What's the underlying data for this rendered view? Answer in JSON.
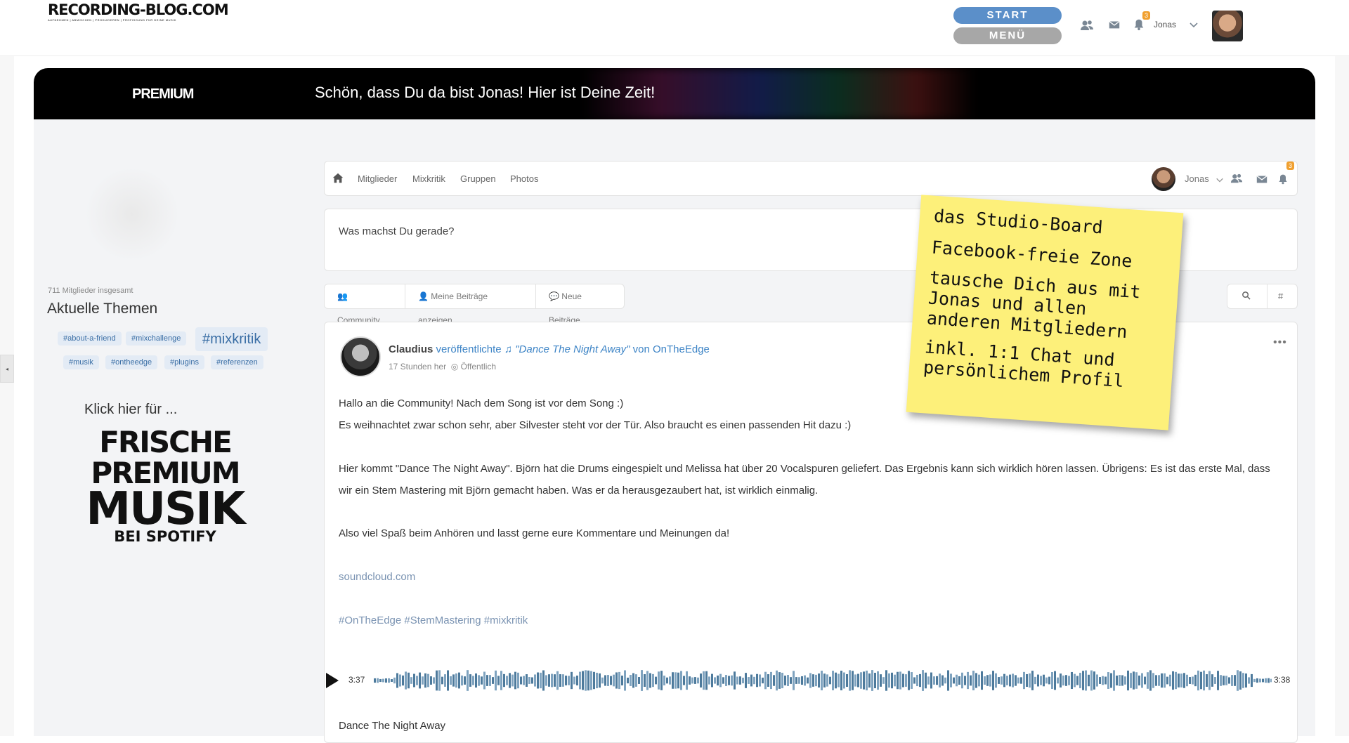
{
  "site": {
    "logo": "RECORDING-BLOG.COM",
    "tagline": "AUFNEHMEN | ABMISCHEN | PRODUZIEREN | PROFISOUND FÜR DEINE MUSIK"
  },
  "header": {
    "start_label": "START",
    "menu_label": "MENÜ",
    "notification_count": "3",
    "user_name": "Jonas"
  },
  "banner": {
    "premium_label": "PREMIUM",
    "welcome_text": "Schön, dass Du da bist Jonas! Hier ist Deine Zeit!"
  },
  "sidebar": {
    "members_count": "711 Mitglieder insgesamt",
    "topics_title": "Aktuelle Themen",
    "tags": [
      "#about-a-friend",
      "#mixchallenge",
      "#mixkritik",
      "#musik",
      "#ontheedge",
      "#plugins",
      "#referenzen"
    ],
    "promo_intro": "Klick hier für ...",
    "promo_lines": [
      "FRISCHE",
      "PREMIUM",
      "MUSIK",
      "BEI SPOTIFY"
    ]
  },
  "nav": {
    "links": [
      "Mitglieder",
      "Mixkritik",
      "Gruppen",
      "Photos"
    ],
    "user_name": "Jonas",
    "notification_count": "3"
  },
  "status": {
    "placeholder": "Was machst Du gerade?"
  },
  "filters": {
    "items": [
      "Community",
      "Meine Beiträge anzeigen",
      "Neue Beiträge"
    ],
    "search_symbol": "#"
  },
  "post": {
    "author": "Claudius",
    "verb": "veröffentlichte",
    "song": "\"Dance The Night Away\"",
    "by": "von",
    "artist": "OnTheEdge",
    "time": "17 Stunden her",
    "visibility": "Öffentlich",
    "paragraphs": [
      "Hallo an die Community! Nach dem Song ist vor dem Song :)",
      "Es weihnachtet zwar schon sehr, aber Silvester steht vor der Tür. Also braucht es einen passenden Hit dazu :)",
      "Hier kommt \"Dance The Night Away\". Björn hat die Drums eingespielt und Melissa hat über 20 Vocalspuren geliefert. Das Ergebnis kann sich wirklich hören lassen. Übrigens: Es ist das erste Mal, dass wir ein Stem Mastering mit Björn gemacht haben. Was er da herausgezaubert hat, ist wirklich einmalig.",
      "Also viel Spaß beim Anhören und lasst gerne eure Kommentare und Meinungen da!"
    ],
    "link": "soundcloud.com",
    "hashtags": "#OnTheEdge #StemMastering #mixkritik",
    "player": {
      "current_time": "3:37",
      "duration": "3:38",
      "progress": 0.995
    },
    "track_title": "Dance The Night Away"
  },
  "sticky_note": {
    "lines": [
      "das Studio-Board",
      "Facebook-freie Zone",
      "tausche Dich aus mit Jonas und allen anderen Mitgliedern",
      "inkl. 1:1 Chat und persönlichem Profil"
    ]
  },
  "colors": {
    "accent": "#5b8fc9",
    "link": "#3d84c6",
    "sticky": "#fdf07a",
    "badge": "#f0a030"
  }
}
